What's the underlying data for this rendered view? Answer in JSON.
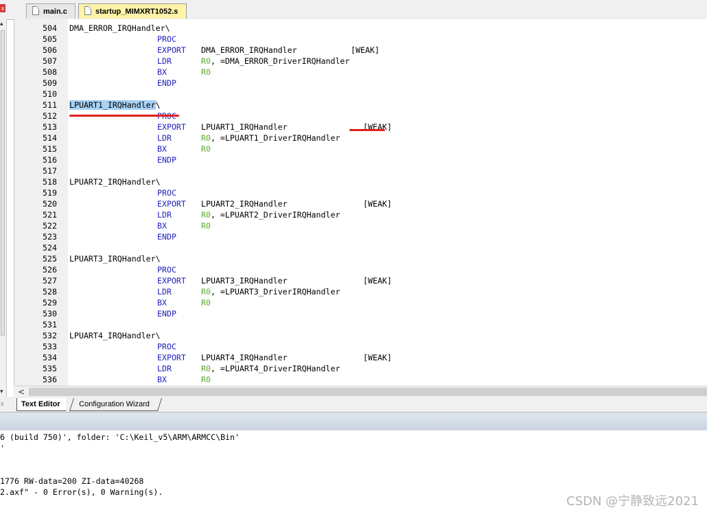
{
  "tabs": [
    {
      "label": "main.c",
      "active": false
    },
    {
      "label": "startup_MIMXRT1052.s",
      "active": true
    }
  ],
  "close_glyph": "x",
  "editor": {
    "lines": [
      {
        "num": "504",
        "label": "DMA_ERROR_IRQHandler\\"
      },
      {
        "num": "505",
        "mnemonic": "PROC"
      },
      {
        "num": "506",
        "mnemonic": "EXPORT",
        "operand": "DMA_ERROR_IRQHandler",
        "option": "[WEAK]"
      },
      {
        "num": "507",
        "mnemonic": "LDR",
        "reg": "R0",
        "rest": ", =DMA_ERROR_DriverIRQHandler"
      },
      {
        "num": "508",
        "mnemonic": "BX",
        "reg": "R0"
      },
      {
        "num": "509",
        "mnemonic": "ENDP"
      },
      {
        "num": "510"
      },
      {
        "num": "511",
        "label": "LPUART1_IRQHandler",
        "label_tail": "\\",
        "highlight": true
      },
      {
        "num": "512",
        "mnemonic": "PROC"
      },
      {
        "num": "513",
        "mnemonic": "EXPORT",
        "operand": "LPUART1_IRQHandler",
        "option": "[WEAK]"
      },
      {
        "num": "514",
        "mnemonic": "LDR",
        "reg": "R0",
        "rest": ", =LPUART1_DriverIRQHandler"
      },
      {
        "num": "515",
        "mnemonic": "BX",
        "reg": "R0"
      },
      {
        "num": "516",
        "mnemonic": "ENDP"
      },
      {
        "num": "517"
      },
      {
        "num": "518",
        "label": "LPUART2_IRQHandler\\"
      },
      {
        "num": "519",
        "mnemonic": "PROC"
      },
      {
        "num": "520",
        "mnemonic": "EXPORT",
        "operand": "LPUART2_IRQHandler",
        "option": "[WEAK]"
      },
      {
        "num": "521",
        "mnemonic": "LDR",
        "reg": "R0",
        "rest": ", =LPUART2_DriverIRQHandler"
      },
      {
        "num": "522",
        "mnemonic": "BX",
        "reg": "R0"
      },
      {
        "num": "523",
        "mnemonic": "ENDP"
      },
      {
        "num": "524"
      },
      {
        "num": "525",
        "label": "LPUART3_IRQHandler\\"
      },
      {
        "num": "526",
        "mnemonic": "PROC"
      },
      {
        "num": "527",
        "mnemonic": "EXPORT",
        "operand": "LPUART3_IRQHandler",
        "option": "[WEAK]"
      },
      {
        "num": "528",
        "mnemonic": "LDR",
        "reg": "R0",
        "rest": ", =LPUART3_DriverIRQHandler"
      },
      {
        "num": "529",
        "mnemonic": "BX",
        "reg": "R0"
      },
      {
        "num": "530",
        "mnemonic": "ENDP"
      },
      {
        "num": "531"
      },
      {
        "num": "532",
        "label": "LPUART4_IRQHandler\\"
      },
      {
        "num": "533",
        "mnemonic": "PROC"
      },
      {
        "num": "534",
        "mnemonic": "EXPORT",
        "operand": "LPUART4_IRQHandler",
        "option": "[WEAK]"
      },
      {
        "num": "535",
        "mnemonic": "LDR",
        "reg": "R0",
        "rest": ", =LPUART4_DriverIRQHandler"
      },
      {
        "num": "536",
        "mnemonic": "BX",
        "reg": "R0"
      }
    ]
  },
  "scroll_left_glyph": "<",
  "bottom_tabs": [
    "Text Editor",
    "Configuration Wizard"
  ],
  "bottom_left_glyph": "s",
  "build_output": [
    "6 (build 750)', folder: 'C:\\Keil_v5\\ARM\\ARMCC\\Bin'",
    "'",
    "",
    "",
    "1776 RW-data=200 ZI-data=40268",
    "2.axf\" - 0 Error(s), 0 Warning(s)."
  ],
  "watermark": "CSDN @宁静致远2021",
  "colors": {
    "mnemonic": "#2020c0",
    "register": "#5ca830",
    "highlight": "#a7d1f5",
    "annotation": "#e0201c",
    "active_tab": "#fff3a8"
  }
}
